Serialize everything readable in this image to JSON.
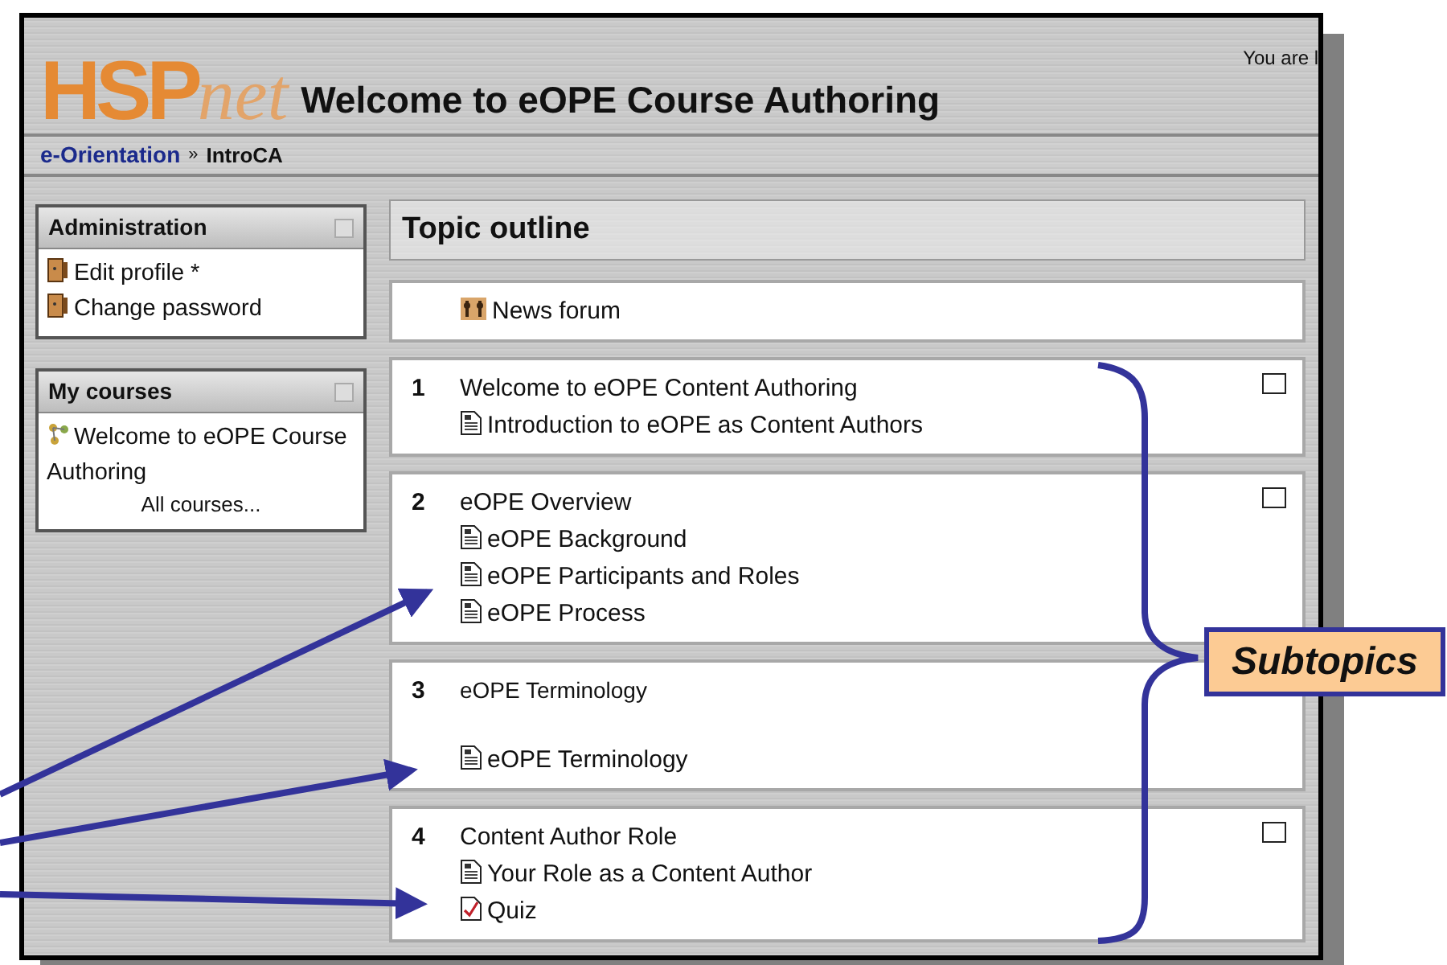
{
  "header": {
    "logo": {
      "main": "HSP",
      "suffix": "net"
    },
    "title": "Welcome to eOPE Course Authoring",
    "login_info": "You are l"
  },
  "breadcrumb": {
    "separator": "»",
    "items": [
      {
        "label": "e-Orientation",
        "kind": "link"
      },
      {
        "label": "IntroCA",
        "kind": "current"
      }
    ]
  },
  "blocks": [
    {
      "title": "Administration",
      "items": [
        {
          "label": "Edit profile *",
          "kind": "profile"
        },
        {
          "label": "Change password",
          "kind": "profile"
        }
      ]
    },
    {
      "title": "My courses",
      "items": [
        {
          "label": "Welcome to eOPE Course Authoring",
          "kind": "course"
        },
        {
          "label": "All courses...",
          "kind": "more"
        }
      ]
    }
  ],
  "topic_outline": {
    "title": "Topic outline",
    "news": {
      "label": "News forum",
      "kind": "forum"
    },
    "sections": [
      {
        "number": "1",
        "title": "Welcome to eOPE Content Authoring",
        "summary_title": false,
        "marker_box": true,
        "activities": [
          {
            "label": "Introduction to eOPE as Content Authors",
            "kind": "resource"
          }
        ]
      },
      {
        "number": "2",
        "title": "eOPE Overview",
        "summary_title": false,
        "marker_box": true,
        "activities": [
          {
            "label": "eOPE Background",
            "kind": "resource"
          },
          {
            "label": "eOPE Participants and Roles",
            "kind": "resource"
          },
          {
            "label": "eOPE Process",
            "kind": "resource"
          }
        ]
      },
      {
        "number": "3",
        "title": "eOPE Terminology",
        "summary_title": true,
        "marker_box": false,
        "activities": [
          {
            "label": "eOPE Terminology",
            "kind": "resource"
          }
        ]
      },
      {
        "number": "4",
        "title": "Content Author Role",
        "summary_title": false,
        "marker_box": true,
        "activities": [
          {
            "label": "Your Role as a Content Author",
            "kind": "resource"
          },
          {
            "label": "Quiz",
            "kind": "quiz"
          }
        ]
      }
    ]
  },
  "callout": {
    "label": "Subtopics"
  }
}
